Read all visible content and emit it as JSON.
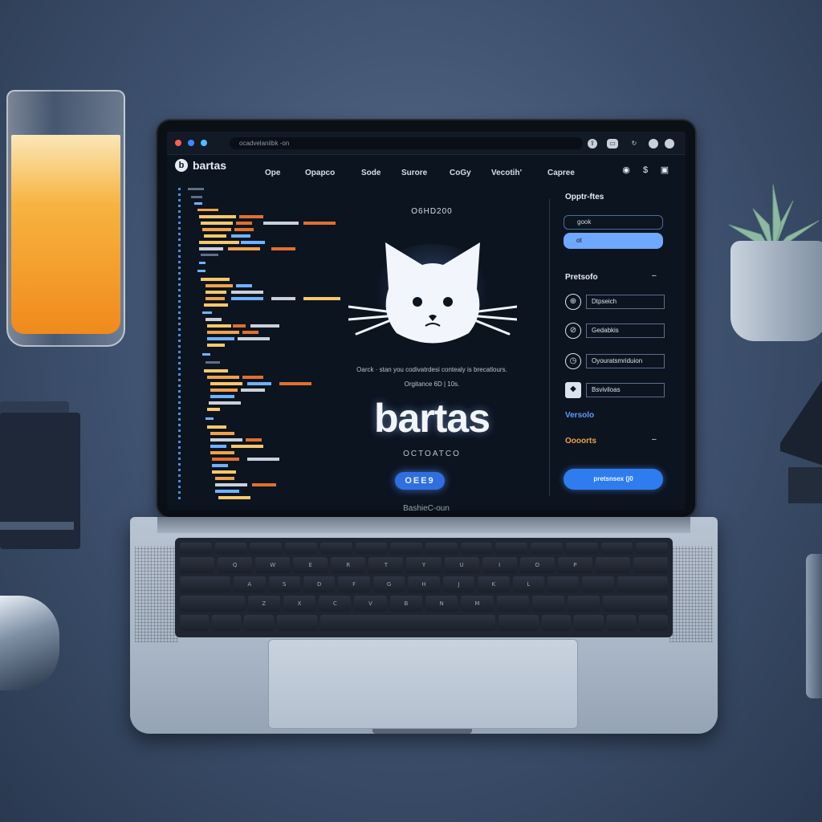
{
  "window": {
    "url": "ocadvelaniibk -on",
    "chin_label": "BashieC-oun"
  },
  "header": {
    "brand": "bartas",
    "nav": [
      "Ope",
      "Opapco",
      "Sode",
      "Surore",
      "CoGy",
      "Vecotih'",
      "Capree"
    ]
  },
  "main": {
    "tag": "O6HD200",
    "description": "Oarck · stan you codivatrdesi contealy is brecatlours.",
    "description2": "Orgitance 6D | 10s.",
    "title": "bartas",
    "subtitle": "OCTOATCO",
    "pill_label": "OEE9"
  },
  "right_panel": {
    "section1_title": "Opptr-ftes",
    "input1": "gook",
    "input2": "ot",
    "section2_title": "Pretsofo",
    "section2_collapse": "–",
    "items": [
      {
        "icon": "globe-icon",
        "label": "Dtpseich"
      },
      {
        "icon": "compass-icon",
        "label": "Gedabkis"
      },
      {
        "icon": "clock-icon",
        "label": "Oyouratsmriduion"
      },
      {
        "icon": "shape-icon",
        "label": "Bsviviloas"
      }
    ],
    "section3_title": "Versolo",
    "section4_title": "Oooorts",
    "section4_collapse": "–",
    "button": "pretsnsex (j0"
  },
  "keyboard": {
    "row2": [
      "",
      "Q",
      "W",
      "E",
      "R",
      "T",
      "Y",
      "U",
      "I",
      "O",
      "P",
      "",
      ""
    ],
    "row3": [
      "",
      "A",
      "S",
      "D",
      "F",
      "G",
      "H",
      "J",
      "K",
      "L",
      "",
      "",
      ""
    ],
    "row4": [
      "",
      "Z",
      "X",
      "C",
      "V",
      "B",
      "N",
      "M",
      "",
      "",
      "",
      ""
    ]
  },
  "colors": {
    "accent": "#2f7cf0",
    "screen_bg": "#0c1420",
    "text": "#e6ecf3"
  }
}
